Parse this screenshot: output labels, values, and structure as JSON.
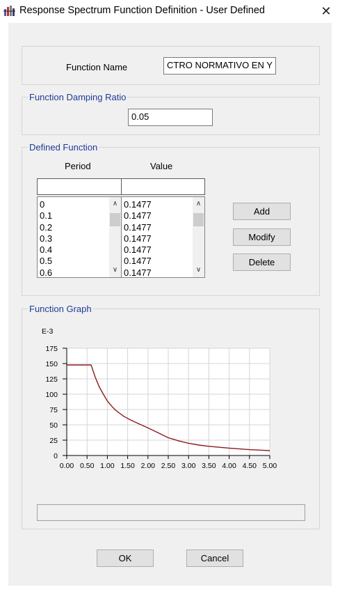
{
  "window": {
    "title": "Response Spectrum Function Definition - User Defined",
    "close_glyph": "✕"
  },
  "function_name": {
    "label": "Function Name",
    "value": "CTRO NORMATIVO EN Y"
  },
  "damping": {
    "group_title": "Function Damping Ratio",
    "value": "0.05"
  },
  "defined_function": {
    "group_title": "Defined Function",
    "period_header": "Period",
    "value_header": "Value",
    "period_input": "",
    "value_input": "",
    "periods": [
      "0",
      "0.1",
      "0.2",
      "0.3",
      "0.4",
      "0.5",
      "0.6"
    ],
    "values": [
      "0.1477",
      "0.1477",
      "0.1477",
      "0.1477",
      "0.1477",
      "0.1477",
      "0.1477"
    ],
    "buttons": {
      "add": "Add",
      "modify": "Modify",
      "delete": "Delete"
    }
  },
  "graph": {
    "group_title": "Function Graph",
    "status_text": ""
  },
  "chart_data": {
    "type": "line",
    "title": "",
    "xlabel": "",
    "ylabel": "",
    "y_multiplier_label": "E-3",
    "xlim": [
      0,
      5
    ],
    "ylim": [
      0,
      175
    ],
    "grid": true,
    "line_color": "#8b1a1a",
    "x_ticks": [
      "0.00",
      "0.50",
      "1.00",
      "1.50",
      "2.00",
      "2.50",
      "3.00",
      "3.50",
      "4.00",
      "4.50",
      "5.00"
    ],
    "y_ticks": [
      "0",
      "25",
      "50",
      "75",
      "100",
      "125",
      "150",
      "175"
    ],
    "series": [
      {
        "x": [
          0,
          0.1,
          0.2,
          0.3,
          0.4,
          0.5,
          0.6,
          0.7,
          0.8,
          0.9,
          1.0,
          1.1,
          1.2,
          1.4,
          1.6,
          1.8,
          2.0,
          2.25,
          2.5,
          2.75,
          3.0,
          3.25,
          3.5,
          4.0,
          4.5,
          5.0
        ],
        "values": [
          147.7,
          147.7,
          147.7,
          147.7,
          147.7,
          147.7,
          147.7,
          128,
          112,
          100,
          89,
          81,
          74,
          64,
          57,
          51,
          45,
          37,
          29,
          24,
          20,
          17,
          15,
          12,
          9.5,
          8
        ]
      }
    ]
  },
  "footer": {
    "ok": "OK",
    "cancel": "Cancel"
  }
}
